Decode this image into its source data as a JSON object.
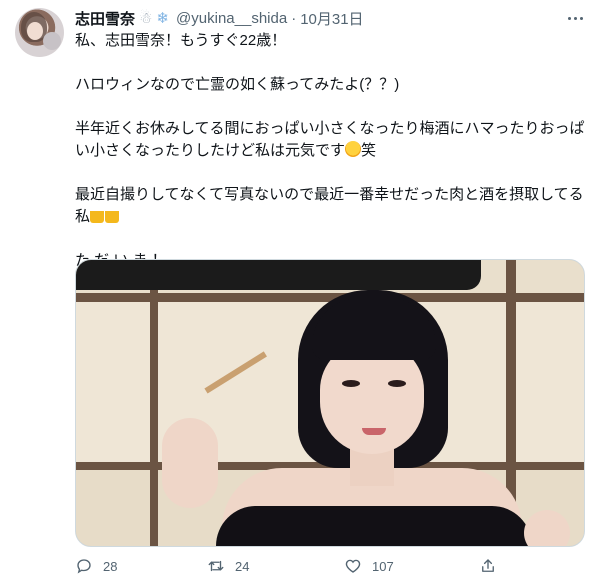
{
  "author": {
    "display_name": "志田雪奈",
    "handle": "@yukina__shida",
    "separator": "·",
    "date": "10月31日",
    "name_emojis": [
      "☃",
      "❄"
    ]
  },
  "tweet": {
    "paragraphs": [
      "私、志田雪奈！もうすぐ22歳！",
      "ハロウィンなので亡霊の如く蘇ってみたよ(？？)",
      "半年近くお休みしてる間におっぱい小さくなったり梅酒にハマったりおっぱい小さくなったりしたけど私は元気です",
      "笑",
      "最近自撮りしてなくて写真ないので最近一番幸せだった肉と酒を摂取してる私",
      "た だ い ま ！"
    ]
  },
  "icons": {
    "more": "more-horizontal-icon",
    "reply": "reply-icon",
    "retweet": "retweet-icon",
    "like": "heart-icon",
    "share": "share-icon"
  },
  "actions": {
    "reply_count": "28",
    "retweet_count": "24",
    "like_count": "107"
  },
  "colors": {
    "text": "#0f1419",
    "secondary": "#536471",
    "border": "#cfd9de"
  }
}
